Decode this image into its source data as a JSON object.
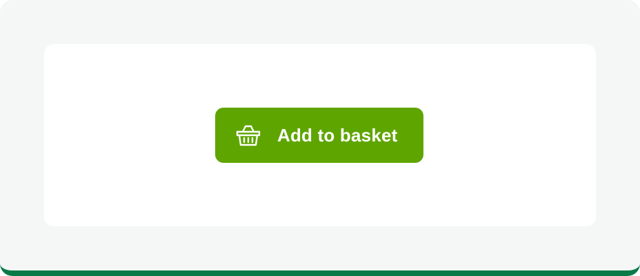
{
  "colors": {
    "outer_background": "#f4f7f6",
    "card_background": "#ffffff",
    "bottom_accent": "#0a7a48",
    "button_background": "#5ea500",
    "button_text": "#ffffff"
  },
  "button": {
    "label": "Add to basket",
    "icon": "basket-icon"
  }
}
